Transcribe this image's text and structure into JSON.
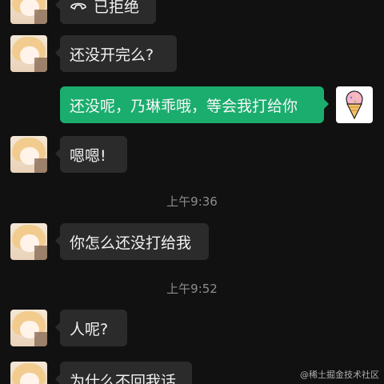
{
  "messages": {
    "m1_text": "已拒绝",
    "m2_text": "还没开完么?",
    "m3_text": "还没呢，乃琳乖哦，等会我打给你",
    "m4_text": "嗯嗯!",
    "m5_text": "你怎么还没打给我",
    "m6_text": "人呢?",
    "m7_text": "为什么不回我话"
  },
  "timestamps": {
    "t1": "上午9:36",
    "t2": "上午9:52"
  },
  "watermark": "@稀土掘金技术社区",
  "colors": {
    "background": "#111111",
    "incoming_bubble": "#2b2b2b",
    "outgoing_bubble": "#1aad6e",
    "timestamp_text": "#8d8d8d"
  },
  "icons": {
    "declined_call": "phone-hangup-icon",
    "sender_avatar": "anime-girl-avatar",
    "self_avatar": "ice-cream-avatar"
  }
}
